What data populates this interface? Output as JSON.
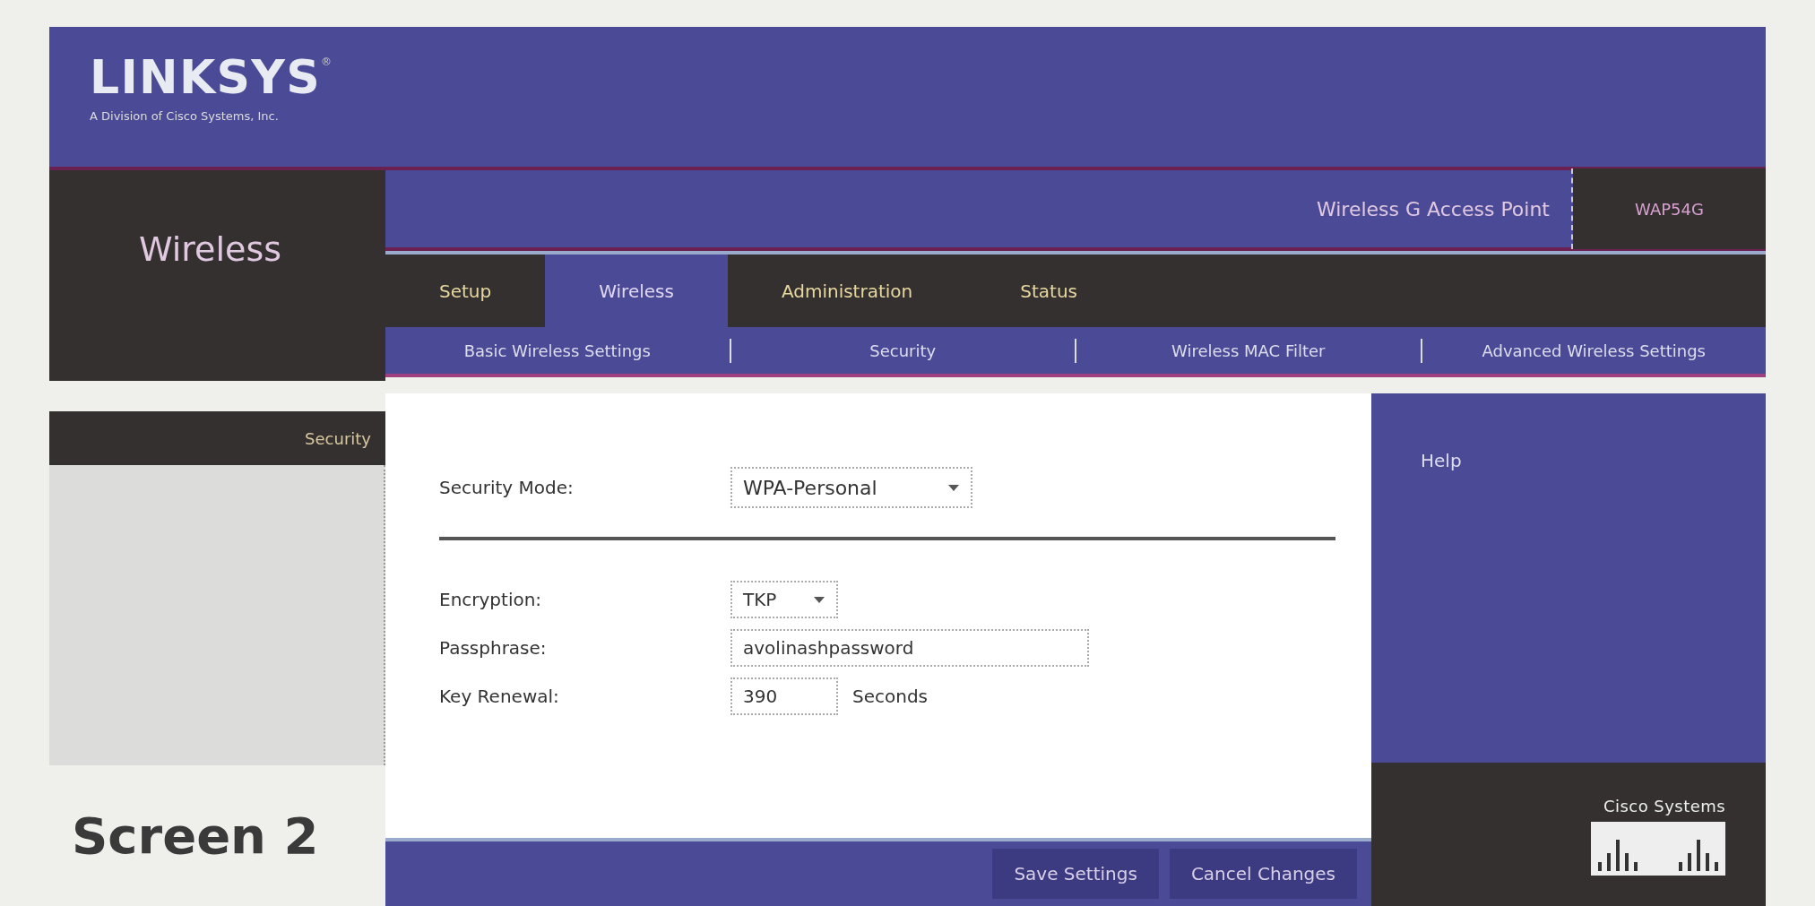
{
  "header": {
    "logo": "LINKSYS",
    "registered_mark": "®",
    "tagline": "A Division of Cisco Systems, Inc."
  },
  "section_title": "Wireless",
  "product": {
    "name": "Wireless G Access Point",
    "model": "WAP54G"
  },
  "tabs": [
    {
      "label": "Setup",
      "selected": false
    },
    {
      "label": "Wireless",
      "selected": true
    },
    {
      "label": "Administration",
      "selected": false
    },
    {
      "label": "Status",
      "selected": false
    }
  ],
  "subtabs": [
    "Basic Wireless Settings",
    "Security",
    "Wireless MAC Filter",
    "Advanced Wireless Settings"
  ],
  "sidebar": {
    "heading": "Security"
  },
  "form": {
    "security_mode": {
      "label": "Security Mode:",
      "value": "WPA-Personal"
    },
    "fields": [
      {
        "kind": "select",
        "label": "Encryption:",
        "value": "TKP"
      },
      {
        "kind": "text",
        "label": "Passphrase:",
        "value": "avolinashpassword"
      },
      {
        "kind": "number",
        "label": "Key Renewal:",
        "value": "390",
        "unit": "Seconds"
      }
    ]
  },
  "help": {
    "title": "Help"
  },
  "footer": {
    "buttons": [
      "Save Settings",
      "Cancel Changes"
    ],
    "brand": "Cisco Systems"
  },
  "caption": "Screen 2"
}
